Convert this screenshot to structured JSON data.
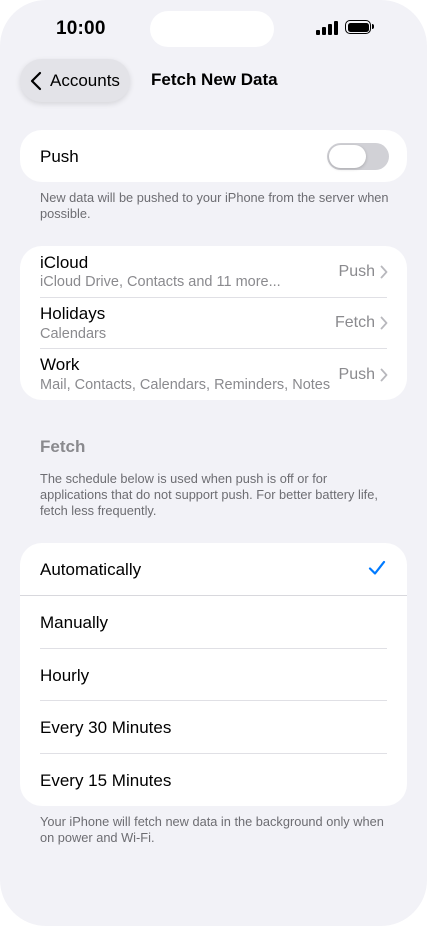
{
  "status": {
    "time": "10:00"
  },
  "nav": {
    "back_label": "Accounts",
    "title": "Fetch New Data"
  },
  "push": {
    "label": "Push",
    "enabled": false,
    "footer": "New data will be pushed to your iPhone from the server when possible."
  },
  "accounts": [
    {
      "name": "iCloud",
      "detail": "iCloud Drive, Contacts and 11 more...",
      "value": "Push"
    },
    {
      "name": "Holidays",
      "detail": "Calendars",
      "value": "Fetch"
    },
    {
      "name": "Work",
      "detail": "Mail, Contacts, Calendars, Reminders, Notes",
      "value": "Push"
    }
  ],
  "fetch": {
    "header": "Fetch",
    "description": "The schedule below is used when push is off or for applications that do not support push. For better battery life, fetch less frequently.",
    "options": [
      {
        "label": "Automatically",
        "selected": true
      },
      {
        "label": "Manually",
        "selected": false
      },
      {
        "label": "Hourly",
        "selected": false
      },
      {
        "label": "Every 30 Minutes",
        "selected": false
      },
      {
        "label": "Every 15 Minutes",
        "selected": false
      }
    ],
    "footer": "Your iPhone will fetch new data in the background only when on power and Wi-Fi."
  },
  "colors": {
    "accent": "#007aff",
    "background": "#f2f2f7",
    "toggle_off": "#d1d1d6"
  }
}
